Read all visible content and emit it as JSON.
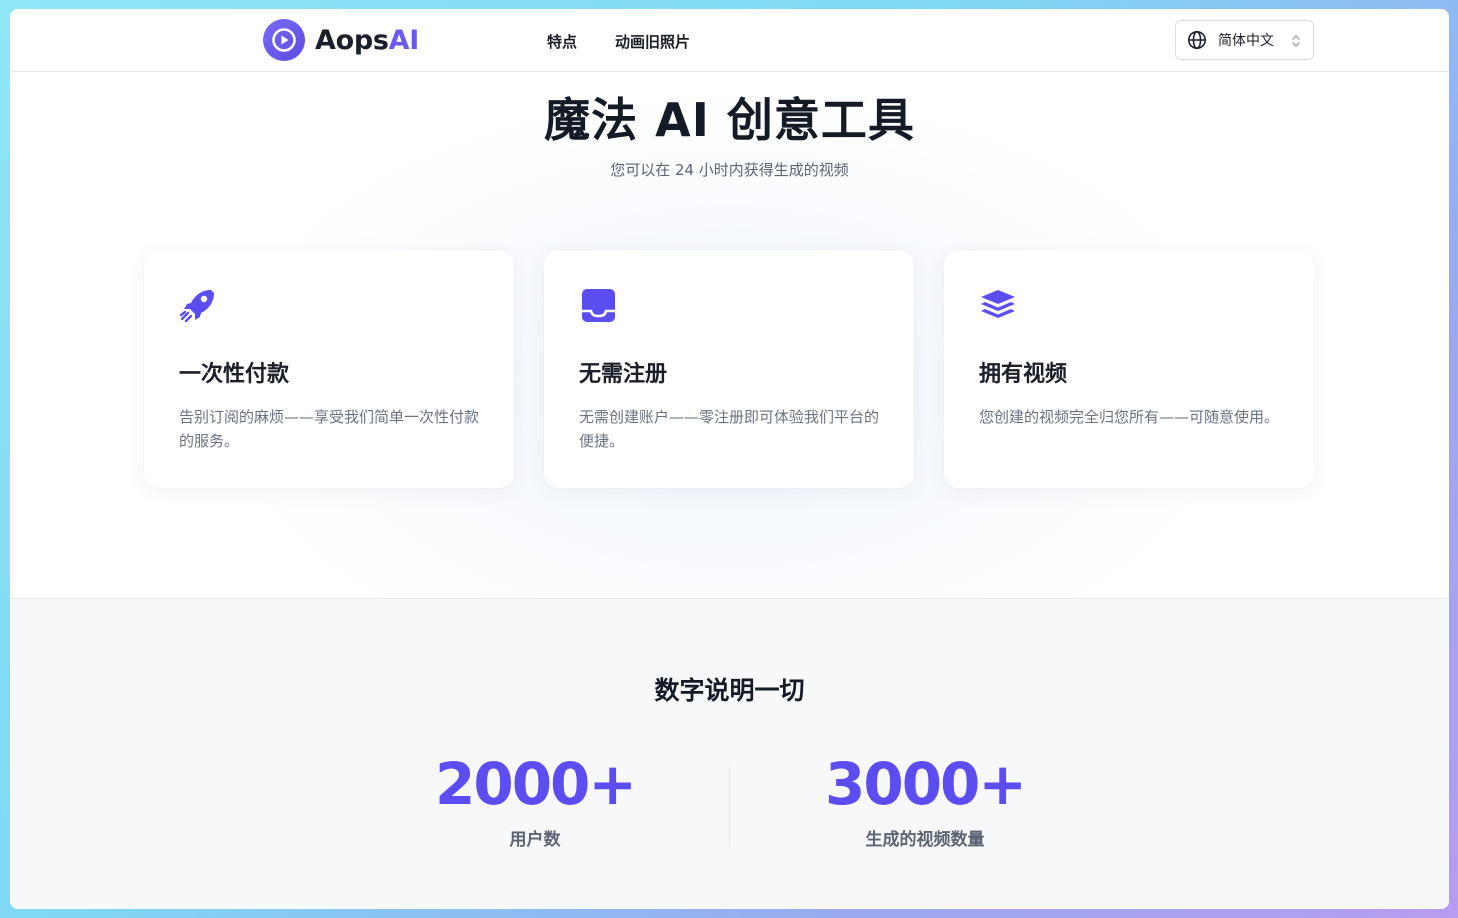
{
  "header": {
    "logo_text": "Aops",
    "logo_accent": "AI",
    "nav": [
      "特点",
      "动画旧照片"
    ],
    "language": "简体中文"
  },
  "hero": {
    "title": "魔法 AI 创意工具",
    "subtitle": "您可以在 24 小时内获得生成的视频"
  },
  "features": [
    {
      "icon": "rocket-icon",
      "title": "一次性付款",
      "desc": "告别订阅的麻烦——享受我们简单一次性付款的服务。"
    },
    {
      "icon": "inbox-icon",
      "title": "无需注册",
      "desc": "无需创建账户——零注册即可体验我们平台的便捷。"
    },
    {
      "icon": "layers-icon",
      "title": "拥有视频",
      "desc": "您创建的视频完全归您所有——可随意使用。"
    }
  ],
  "stats": {
    "title": "数字说明一切",
    "items": [
      {
        "value": "2000+",
        "label": "用户数"
      },
      {
        "value": "3000+",
        "label": "生成的视频数量"
      }
    ]
  },
  "colors": {
    "accent": "#5b4df0",
    "heading": "#141a26",
    "muted": "#6a7282"
  }
}
